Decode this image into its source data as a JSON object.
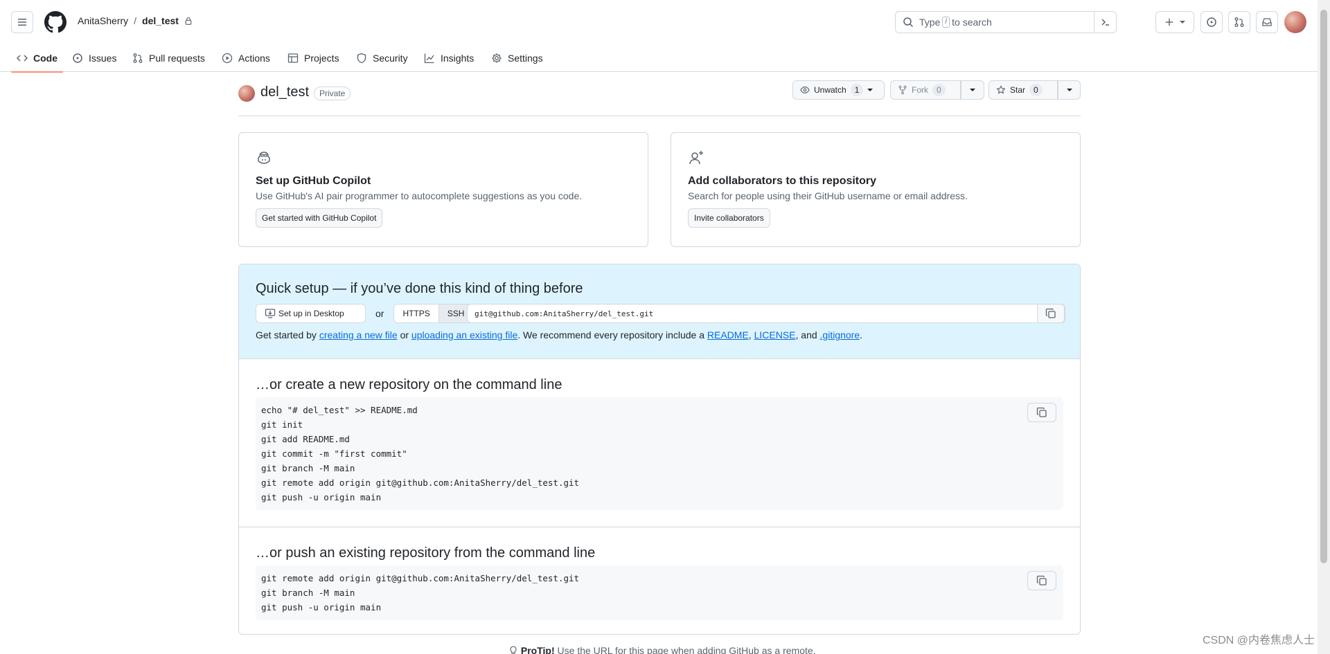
{
  "header": {
    "owner": "AnitaSherry",
    "separator": "/",
    "repo": "del_test",
    "search_placeholder_pre": "Type",
    "search_key": "/",
    "search_placeholder_post": "to search"
  },
  "nav": {
    "tabs": [
      {
        "label": "Code",
        "icon": "code-icon"
      },
      {
        "label": "Issues",
        "icon": "issue-icon"
      },
      {
        "label": "Pull requests",
        "icon": "pull-request-icon"
      },
      {
        "label": "Actions",
        "icon": "play-icon"
      },
      {
        "label": "Projects",
        "icon": "table-icon"
      },
      {
        "label": "Security",
        "icon": "shield-icon"
      },
      {
        "label": "Insights",
        "icon": "graph-icon"
      },
      {
        "label": "Settings",
        "icon": "gear-icon"
      }
    ]
  },
  "repo": {
    "name": "del_test",
    "visibility": "Private",
    "unwatch_label": "Unwatch",
    "watch_count": "1",
    "fork_label": "Fork",
    "fork_count": "0",
    "star_label": "Star",
    "star_count": "0"
  },
  "cards": {
    "copilot": {
      "title": "Set up GitHub Copilot",
      "desc": "Use GitHub's AI pair programmer to autocomplete suggestions as you code.",
      "button": "Get started with GitHub Copilot"
    },
    "collab": {
      "title": "Add collaborators to this repository",
      "desc": "Search for people using their GitHub username or email address.",
      "button": "Invite collaborators"
    }
  },
  "quick_setup": {
    "title": "Quick setup — if you’ve done this kind of thing before",
    "desktop_btn": "Set up in Desktop",
    "or": "or",
    "https": "HTTPS",
    "ssh": "SSH",
    "url": "git@github.com:AnitaSherry/del_test.git",
    "hint_pre": "Get started by",
    "link_new_file": "creating a new file",
    "hint_or": "or",
    "link_upload": "uploading an existing file",
    "hint_mid": ". We recommend every repository include a",
    "link_readme": "README",
    "comma1": ",",
    "link_license": "LICENSE",
    "hint_and": ", and",
    "link_gitignore": ".gitignore",
    "period": "."
  },
  "new_repo": {
    "title": "…or create a new repository on the command line",
    "lines": [
      "echo \"# del_test\" >> README.md",
      "git init",
      "git add README.md",
      "git commit -m \"first commit\"",
      "git branch -M main",
      "git remote add origin git@github.com:AnitaSherry/del_test.git",
      "git push -u origin main"
    ]
  },
  "push_existing": {
    "title": "…or push an existing repository from the command line",
    "lines": [
      "git remote add origin git@github.com:AnitaSherry/del_test.git",
      "git branch -M main",
      "git push -u origin main"
    ]
  },
  "protip": {
    "label": "ProTip!",
    "text": "Use the URL for this page when adding GitHub as a remote."
  },
  "watermark": "CSDN @内卷焦虑人士",
  "colors": {
    "accent_tab": "#fd8c73",
    "link": "#0969da",
    "quick_bg": "#ddf4ff"
  }
}
